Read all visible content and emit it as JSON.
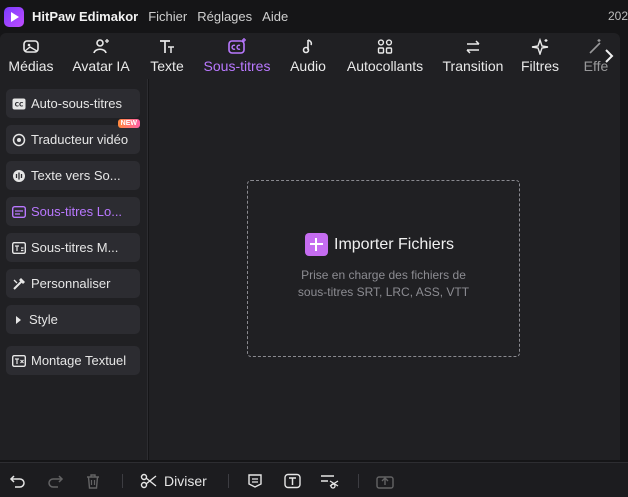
{
  "app": {
    "title": "HitPaw Edimakor",
    "year_fragment": "202"
  },
  "menu": [
    "Fichier",
    "Réglages",
    "Aide"
  ],
  "tabs": [
    {
      "label": "Médias",
      "icon": "media-icon"
    },
    {
      "label": "Avatar IA",
      "icon": "avatar-icon"
    },
    {
      "label": "Texte",
      "icon": "text-icon"
    },
    {
      "label": "Sous-titres",
      "icon": "subtitles-icon",
      "active": true
    },
    {
      "label": "Audio",
      "icon": "audio-icon"
    },
    {
      "label": "Autocollants",
      "icon": "stickers-icon"
    },
    {
      "label": "Transition",
      "icon": "transition-icon"
    },
    {
      "label": "Filtres",
      "icon": "filters-icon"
    },
    {
      "label": "Effe",
      "icon": "effects-icon"
    }
  ],
  "sidebar": {
    "items": [
      {
        "label": "Auto-sous-titres",
        "icon": "cc-icon"
      },
      {
        "label": "Traducteur vidéo",
        "icon": "translate-icon",
        "badge": "NEW"
      },
      {
        "label": "Texte vers So...",
        "icon": "text-to-speech-icon"
      },
      {
        "label": "Sous-titres Lo...",
        "icon": "local-subtitles-icon",
        "active": true
      },
      {
        "label": "Sous-titres M...",
        "icon": "manual-subtitles-icon"
      },
      {
        "label": "Personnaliser",
        "icon": "customize-icon"
      },
      {
        "label": "Style",
        "icon": "chevron-right-icon"
      },
      {
        "label": "Montage Textuel",
        "icon": "text-edit-icon"
      }
    ]
  },
  "main": {
    "import_label": "Importer Fichiers",
    "support_line1": "Prise en charge des fichiers de",
    "support_line2": "sous-titres SRT, LRC, ASS, VTT"
  },
  "bottombar": {
    "split_label": "Diviser"
  },
  "colors": {
    "accent": "#b978ff",
    "import_button": "#c56cf0",
    "background": "#202023"
  }
}
